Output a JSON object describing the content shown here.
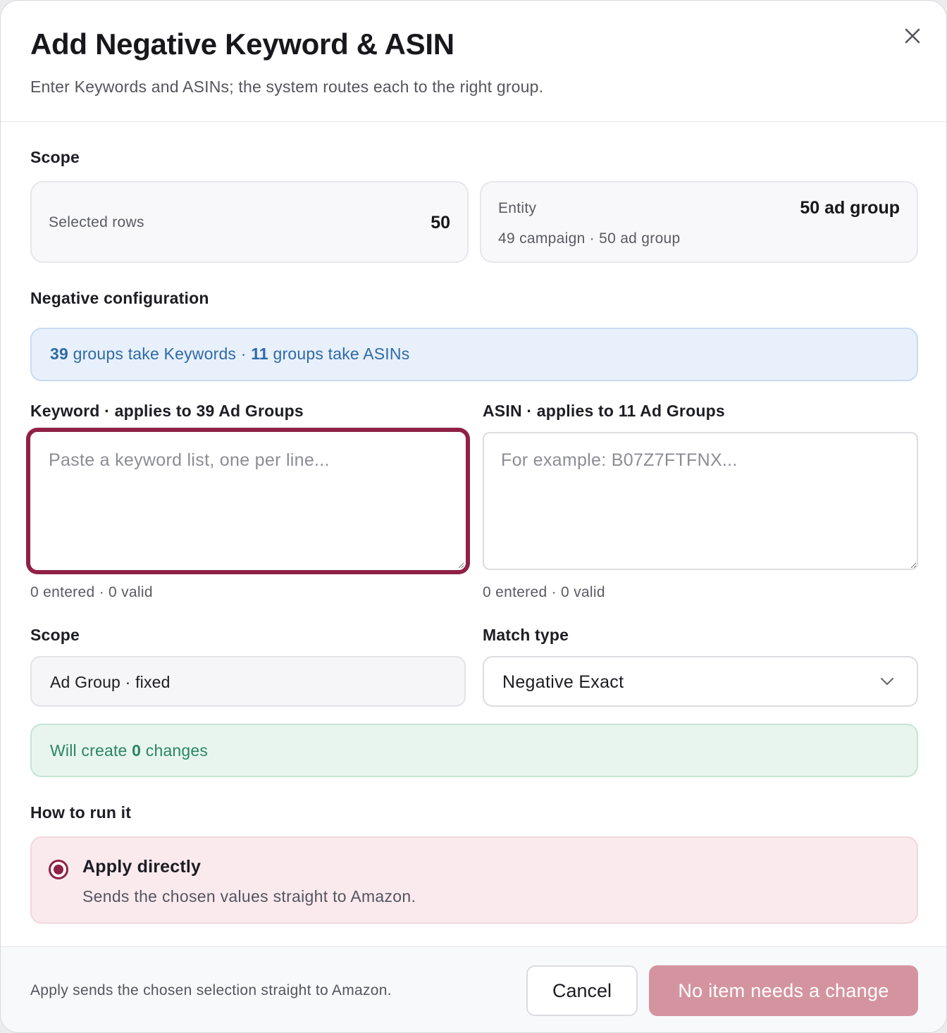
{
  "dialog": {
    "title": "Add Negative Keyword & ASIN",
    "subtitle": "Enter Keywords and ASINs; the system routes each to the right group.",
    "close_icon": "close-icon"
  },
  "scope_section": {
    "label": "Scope",
    "selected_rows": {
      "label": "Selected rows",
      "value": "50"
    },
    "entity": {
      "label": "Entity",
      "value": "50 ad group",
      "detail": "49 campaign · 50 ad group"
    }
  },
  "negative_config": {
    "label": "Negative configuration",
    "banner": {
      "keyword_count": "39",
      "keyword_text": " groups take Keywords · ",
      "asin_count": "11",
      "asin_text": " groups take ASINs"
    }
  },
  "keyword_field": {
    "label": "Keyword · applies to 39 Ad Groups",
    "value": "",
    "placeholder": "Paste a keyword list, one per line...",
    "counter": "0 entered · 0 valid"
  },
  "asin_field": {
    "label": "ASIN · applies to 11 Ad Groups",
    "value": "",
    "placeholder": "For example: B07Z7FTFNX...",
    "counter": "0 entered · 0 valid"
  },
  "scope_fixed": {
    "label": "Scope",
    "value": "Ad Group · fixed"
  },
  "match_type": {
    "label": "Match type",
    "selected": "Negative Exact",
    "icon": "chevron-down-icon"
  },
  "changes_banner": {
    "prefix": "Will create ",
    "count": "0",
    "suffix": " changes"
  },
  "run_mode": {
    "label": "How to run it",
    "option_title": "Apply directly",
    "option_desc": "Sends the chosen values straight to Amazon."
  },
  "footer": {
    "note": "Apply sends the chosen selection straight to Amazon.",
    "cancel_label": "Cancel",
    "primary_label": "No item needs a change"
  },
  "colors": {
    "accent": "#8f2146",
    "primary_disabled": "#d4949f",
    "info": "#2e6aa8",
    "success": "#2b8563"
  }
}
